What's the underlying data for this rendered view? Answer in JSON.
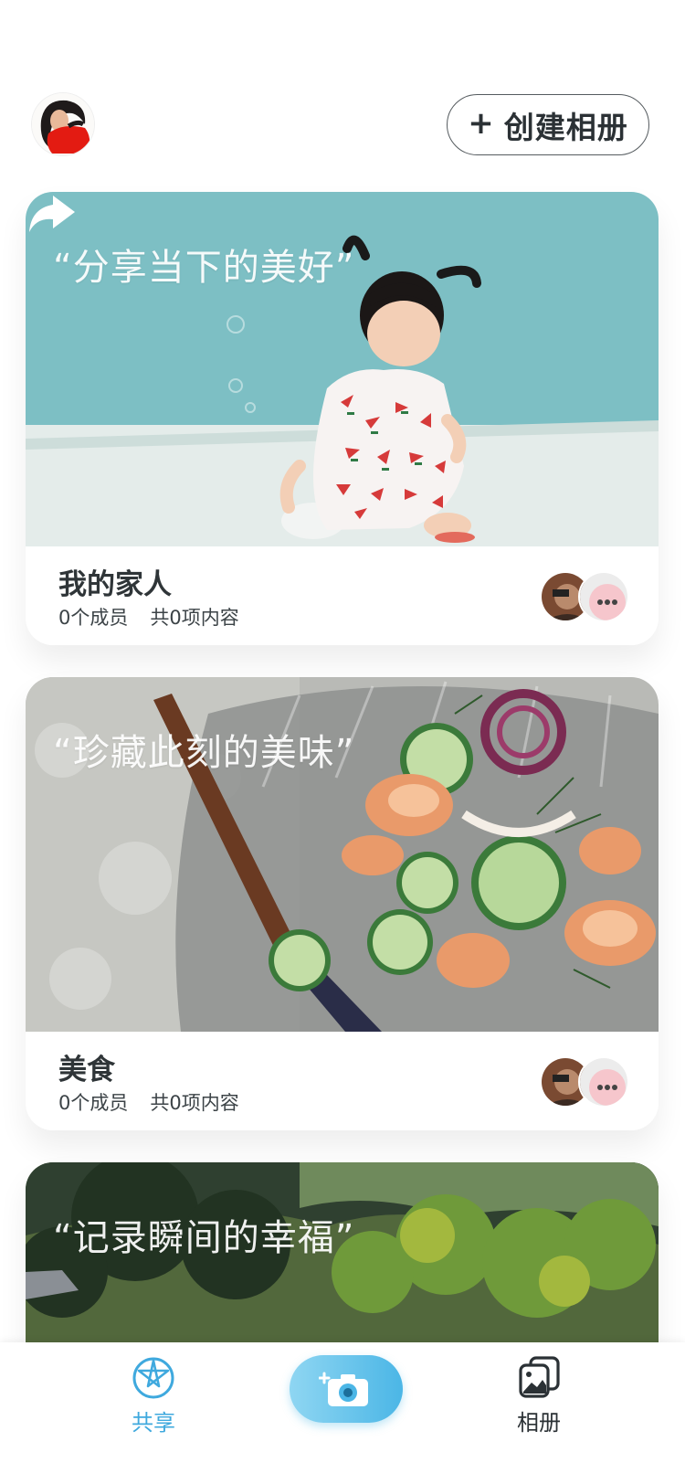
{
  "header": {
    "avatar": "user-avatar",
    "create_album_icon": "+",
    "create_album_label": "创建相册"
  },
  "albums": [
    {
      "quote": "“分享当下的美好”",
      "title": "我的家人",
      "members": "0个成员",
      "items": "共0项内容",
      "share_icon": "share-arrow-icon"
    },
    {
      "quote": "“珍藏此刻的美味”",
      "title": "美食",
      "members": "0个成员",
      "items": "共0项内容"
    },
    {
      "quote": "“记录瞬间的幸福”"
    }
  ],
  "tabbar": {
    "share_label": "共享",
    "album_label": "相册",
    "camera_icon": "camera-add-icon",
    "active_tab": "共享"
  },
  "colors": {
    "accent": "#3fa9de",
    "camera_gradient_start": "#8fd6f2",
    "camera_gradient_end": "#4bb6e6",
    "text": "#2b3135"
  }
}
